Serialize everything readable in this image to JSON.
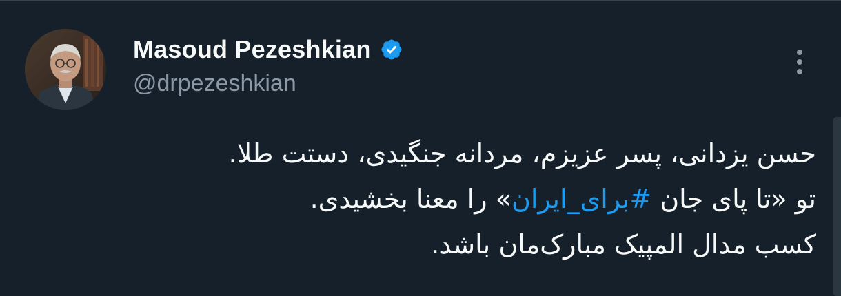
{
  "tweet": {
    "author": {
      "display_name": "Masoud Pezeshkian",
      "handle": "@drpezeshkian",
      "verified": true,
      "verified_icon": "verified-badge-icon",
      "avatar_icon": "avatar-photo"
    },
    "menu_icon": "more-options-icon",
    "text": {
      "line1": "حسن یزدانی، پسر عزیزم، مردانه جنگیدی، دستت طلا.",
      "line2_before": "تو «تا پای جان ",
      "line2_hashtag": "#برای_ایران",
      "line2_after": "» را معنا بخشیدی.",
      "line3": "کسب مدال المپیک مبارک‌مان باشد."
    }
  },
  "colors": {
    "background": "#15202b",
    "text_primary": "#f7f9f9",
    "text_secondary": "#8b98a5",
    "link": "#1d9bf0",
    "verified": "#1d9bf0"
  }
}
